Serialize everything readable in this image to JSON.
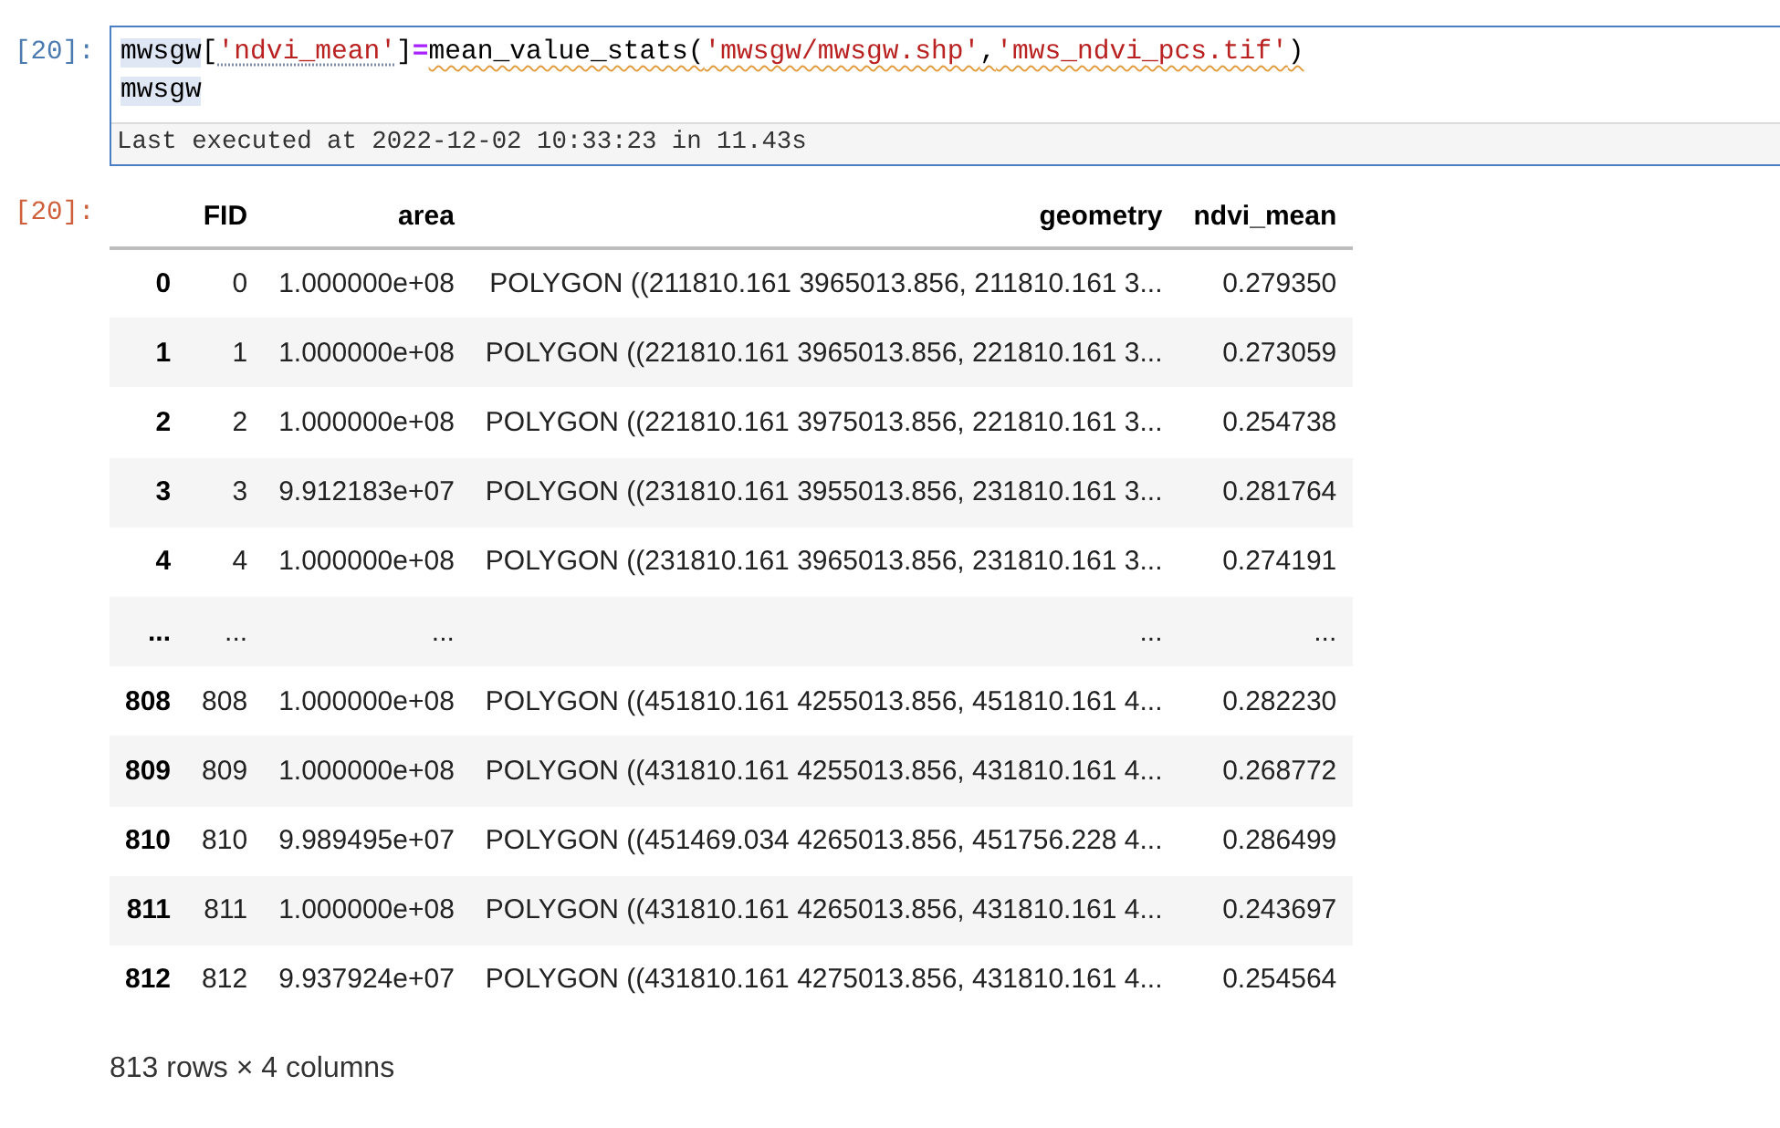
{
  "code_cell": {
    "prompt": "[20]:",
    "lines": [
      {
        "tokens": [
          {
            "text": "mwsgw",
            "kind": "variable",
            "hint": false,
            "warning": false
          },
          {
            "text": "[",
            "kind": "punctuation",
            "hint": false,
            "warning": false
          },
          {
            "text": "'ndvi_mean'",
            "kind": "string",
            "hint": true,
            "warning": false
          },
          {
            "text": "]",
            "kind": "punctuation",
            "hint": false,
            "warning": false
          },
          {
            "text": "=",
            "kind": "operator",
            "hint": false,
            "warning": false
          },
          {
            "text": "mean_value_stats(",
            "kind": "function",
            "hint": false,
            "warning": true
          },
          {
            "text": "'mwsgw/mwsgw.shp'",
            "kind": "string",
            "hint": false,
            "warning": true
          },
          {
            "text": ",",
            "kind": "punctuation",
            "hint": false,
            "warning": true
          },
          {
            "text": "'mws_ndvi_pcs.tif'",
            "kind": "string",
            "hint": false,
            "warning": true
          },
          {
            "text": ")",
            "kind": "punctuation",
            "hint": false,
            "warning": true
          }
        ]
      },
      {
        "tokens": [
          {
            "text": "mwsgw",
            "kind": "variable",
            "hint": false,
            "warning": false
          }
        ]
      }
    ],
    "status": "Last executed at 2022-12-02 10:33:23 in 11.43s"
  },
  "output": {
    "prompt": "[20]:",
    "table": {
      "columns": [
        "FID",
        "area",
        "geometry",
        "ndvi_mean"
      ],
      "rows": [
        {
          "index": "0",
          "cells": [
            "0",
            "1.000000e+08",
            "POLYGON ((211810.161 3965013.856, 211810.161 3...",
            "0.279350"
          ]
        },
        {
          "index": "1",
          "cells": [
            "1",
            "1.000000e+08",
            "POLYGON ((221810.161 3965013.856, 221810.161 3...",
            "0.273059"
          ]
        },
        {
          "index": "2",
          "cells": [
            "2",
            "1.000000e+08",
            "POLYGON ((221810.161 3975013.856, 221810.161 3...",
            "0.254738"
          ]
        },
        {
          "index": "3",
          "cells": [
            "3",
            "9.912183e+07",
            "POLYGON ((231810.161 3955013.856, 231810.161 3...",
            "0.281764"
          ]
        },
        {
          "index": "4",
          "cells": [
            "4",
            "1.000000e+08",
            "POLYGON ((231810.161 3965013.856, 231810.161 3...",
            "0.274191"
          ]
        },
        {
          "index": "...",
          "cells": [
            "...",
            "...",
            "...",
            "..."
          ]
        },
        {
          "index": "808",
          "cells": [
            "808",
            "1.000000e+08",
            "POLYGON ((451810.161 4255013.856, 451810.161 4...",
            "0.282230"
          ]
        },
        {
          "index": "809",
          "cells": [
            "809",
            "1.000000e+08",
            "POLYGON ((431810.161 4255013.856, 431810.161 4...",
            "0.268772"
          ]
        },
        {
          "index": "810",
          "cells": [
            "810",
            "9.989495e+07",
            "POLYGON ((451469.034 4265013.856, 451756.228 4...",
            "0.286499"
          ]
        },
        {
          "index": "811",
          "cells": [
            "811",
            "1.000000e+08",
            "POLYGON ((431810.161 4265013.856, 431810.161 4...",
            "0.243697"
          ]
        },
        {
          "index": "812",
          "cells": [
            "812",
            "9.937924e+07",
            "POLYGON ((431810.161 4275013.856, 431810.161 4...",
            "0.254564"
          ]
        }
      ]
    },
    "shape_note": "813 rows × 4 columns"
  }
}
